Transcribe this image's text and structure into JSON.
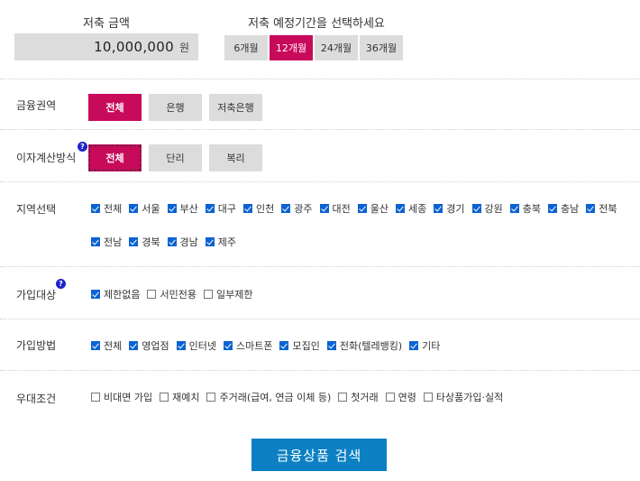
{
  "amount": {
    "label": "저축 금액",
    "value": "10,000,000",
    "unit": "원"
  },
  "period": {
    "label": "저축 예정기간을 선택하세요",
    "options": [
      "6개월",
      "12개월",
      "24개월",
      "36개월"
    ]
  },
  "sector": {
    "label": "금융권역",
    "options": [
      "전체",
      "은행",
      "저축은행"
    ]
  },
  "interest": {
    "label": "이자계산방식",
    "help": "?",
    "options": [
      "전체",
      "단리",
      "복리"
    ]
  },
  "region": {
    "label": "지역선택",
    "line1": [
      "전체",
      "서울",
      "부산",
      "대구",
      "인천",
      "광주",
      "대전",
      "울산",
      "세종",
      "경기",
      "강원",
      "충북",
      "충남",
      "전북"
    ],
    "line2": [
      "전남",
      "경북",
      "경남",
      "제주"
    ]
  },
  "target": {
    "label": "가입대상",
    "help": "?",
    "options": [
      "제한없음",
      "서민전용",
      "일부제한"
    ]
  },
  "method": {
    "label": "가입방법",
    "options": [
      "전체",
      "영업점",
      "인터넷",
      "스마트폰",
      "모집인",
      "전화(텔레뱅킹)",
      "기타"
    ]
  },
  "benefit": {
    "label": "우대조건",
    "options": [
      "비대면 가입",
      "재예치",
      "주거래(급여, 연금 이체 등)",
      "첫거래",
      "연령",
      "타상품가입·실적"
    ]
  },
  "search": {
    "label": "금융상품 검색"
  },
  "colors": {
    "accent": "#c80a5b",
    "check": "#0b63d1",
    "search": "#0c80c3"
  }
}
